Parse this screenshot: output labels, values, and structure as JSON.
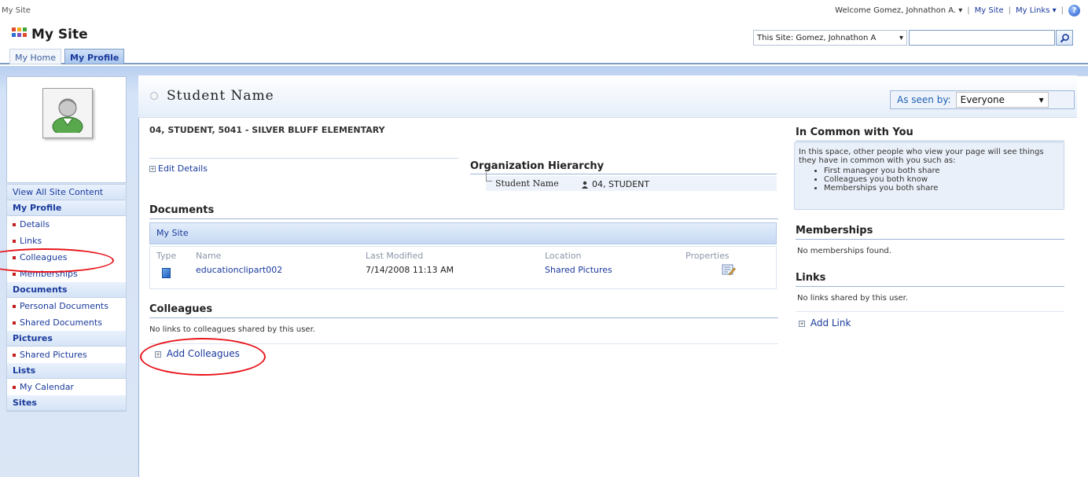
{
  "topbar": {
    "site_label": "My Site",
    "welcome": "Welcome Gomez, Johnathon A.",
    "my_site": "My Site",
    "my_links": "My Links",
    "help_icon": "help-icon"
  },
  "header": {
    "title": "My Site",
    "search_scope": "This Site: Gomez, Johnathon A",
    "search_placeholder": ""
  },
  "tabs": [
    {
      "label": "My Home",
      "selected": false
    },
    {
      "label": "My Profile",
      "selected": true
    }
  ],
  "leftnav": {
    "view_all": "View All Site Content",
    "sections": [
      {
        "heading": "My Profile",
        "items": [
          "Details",
          "Links",
          "Colleagues",
          "Memberships"
        ]
      },
      {
        "heading": "Documents",
        "items": [
          "Personal Documents",
          "Shared Documents"
        ]
      },
      {
        "heading": "Pictures",
        "items": [
          "Shared Pictures"
        ]
      },
      {
        "heading": "Lists",
        "items": [
          "My Calendar"
        ]
      },
      {
        "heading": "Sites",
        "items": []
      }
    ]
  },
  "profile": {
    "name": "Student Name",
    "seen_by_label": "As seen by:",
    "seen_by_value": "Everyone",
    "org_line": "04, STUDENT, 5041 - SILVER BLUFF ELEMENTARY",
    "edit_details": "Edit Details"
  },
  "org_hierarchy": {
    "heading": "Organization Hierarchy",
    "name": "Student Name",
    "title": "04, STUDENT"
  },
  "documents": {
    "heading": "Documents",
    "bar_label": "My Site",
    "columns": [
      "Type",
      "Name",
      "Last Modified",
      "Location",
      "Properties"
    ],
    "rows": [
      {
        "name": "educationclipart002",
        "modified": "7/14/2008 11:13 AM",
        "location": "Shared Pictures"
      }
    ]
  },
  "colleagues": {
    "heading": "Colleagues",
    "empty_text": "No links to colleagues shared by this user.",
    "add_label": "Add Colleagues"
  },
  "in_common": {
    "heading": "In Common with You",
    "intro": "In this space, other people who view your page will see things they have in common with you such as:",
    "bullets": [
      "First manager you both share",
      "Colleagues you both know",
      "Memberships you both share"
    ]
  },
  "memberships": {
    "heading": "Memberships",
    "empty_text": "No memberships found."
  },
  "links": {
    "heading": "Links",
    "empty_text": "No links shared by this user.",
    "add_label": "Add Link"
  },
  "colors": {
    "accent_blue": "#1a3a9c",
    "frame_blue": "#c6d9f3",
    "annotation_red": "#e8141b"
  }
}
